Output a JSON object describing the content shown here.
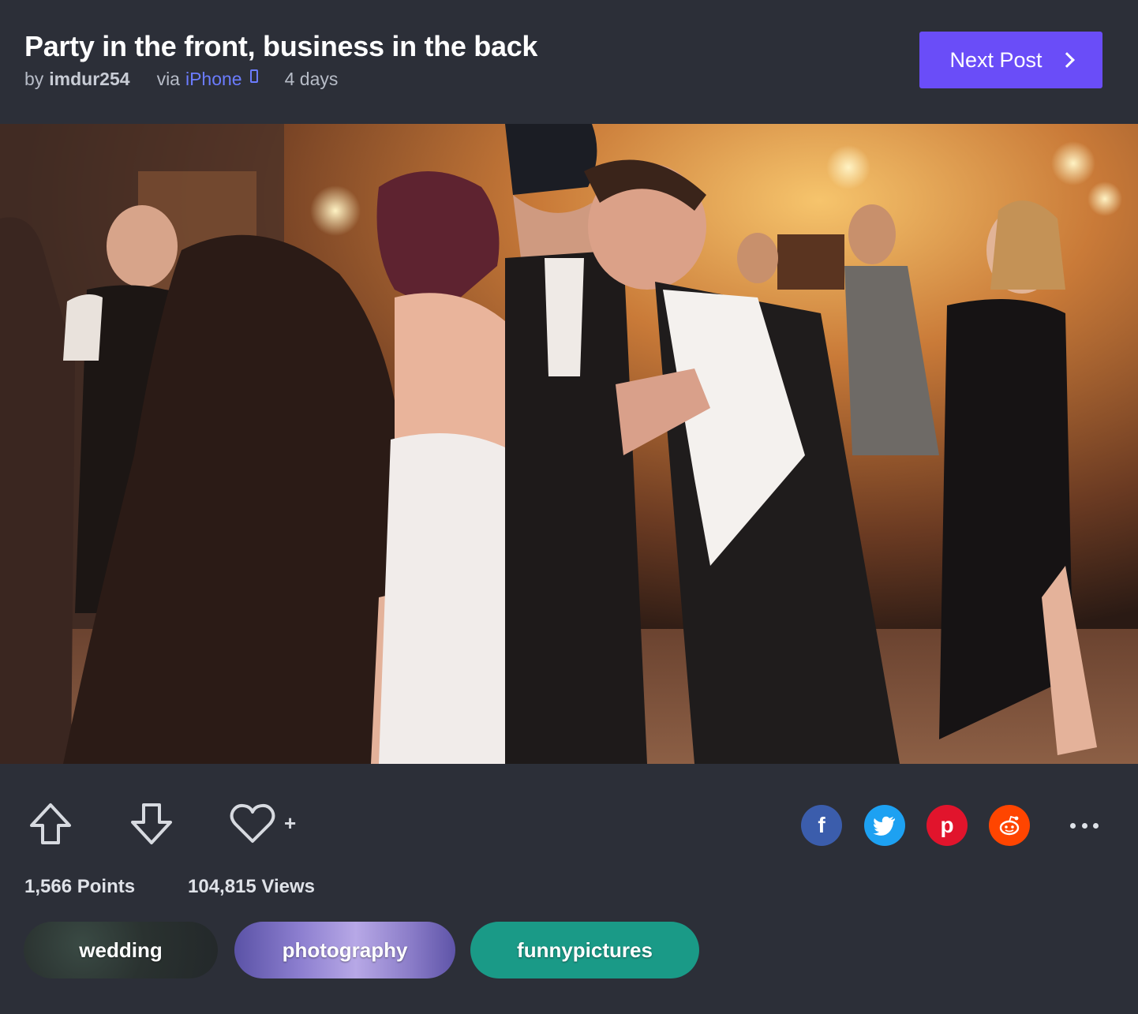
{
  "post": {
    "title": "Party in the front, business in the back",
    "by_label": "by",
    "author": "imdur254",
    "via_label": "via",
    "platform": "iPhone",
    "platform_icon": "phone-icon",
    "age": "4 days"
  },
  "next_post": {
    "label": "Next Post",
    "icon": "chevron-right-icon"
  },
  "image": {
    "description": "photo"
  },
  "actions": {
    "upvote_icon": "upvote-arrow-icon",
    "downvote_icon": "downvote-arrow-icon",
    "favorite_icon": "heart-icon",
    "favorite_plus": "+",
    "share": [
      {
        "name": "facebook",
        "glyph": "f",
        "color": "#3b5dac"
      },
      {
        "name": "twitter",
        "glyph": "bird",
        "color": "#1da1f2"
      },
      {
        "name": "pinterest",
        "glyph": "p",
        "color": "#e1142c"
      },
      {
        "name": "reddit",
        "glyph": "alien",
        "color": "#ff4500"
      }
    ],
    "more_icon": "ellipsis-icon"
  },
  "stats": {
    "points": "1,566 Points",
    "views": "104,815 Views"
  },
  "tags": [
    {
      "label": "wedding"
    },
    {
      "label": "photography"
    },
    {
      "label": "funnypictures"
    }
  ],
  "colors": {
    "background": "#2c2f38",
    "accent": "#6a4df8",
    "link": "#6b7cff",
    "tag_teal": "#1a9a87"
  }
}
